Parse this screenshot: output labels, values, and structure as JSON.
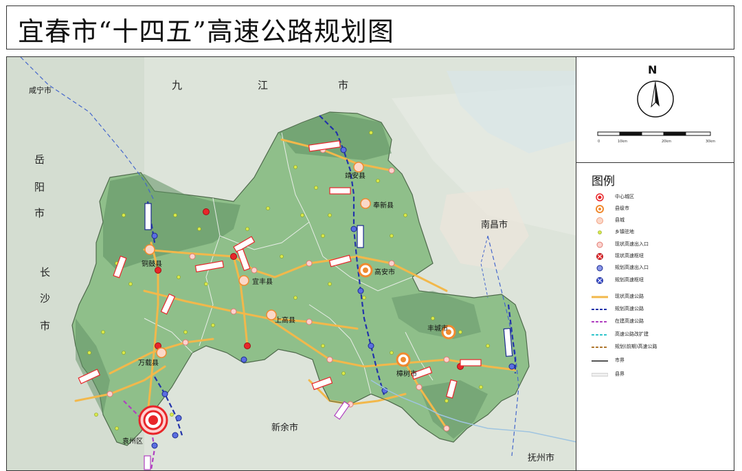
{
  "title": "宜春市“十四五”高速公路规划图",
  "north_label": "N",
  "scale_bar": {
    "ticks": [
      "0",
      "10km",
      "20km",
      "30km"
    ]
  },
  "legend": {
    "title": "图例",
    "items": [
      {
        "label": "中心城区",
        "icon": "center-city-icon"
      },
      {
        "label": "县级市",
        "icon": "county-city-icon"
      },
      {
        "label": "县城",
        "icon": "county-town-icon"
      },
      {
        "label": "乡镇驻地",
        "icon": "township-icon"
      },
      {
        "label": "现状高速出入口",
        "icon": "existing-exit-icon"
      },
      {
        "label": "现状高速枢纽",
        "icon": "existing-hub-icon"
      },
      {
        "label": "规划高速出入口",
        "icon": "planned-exit-icon"
      },
      {
        "label": "规划高速枢纽",
        "icon": "planned-hub-icon"
      },
      {
        "label": "现状高速公路",
        "icon": "existing-expressway-line"
      },
      {
        "label": "规划高速公路",
        "icon": "planned-expressway-line"
      },
      {
        "label": "在建高速公路",
        "icon": "under-construction-line"
      },
      {
        "label": "高速公路改扩建",
        "icon": "expansion-line"
      },
      {
        "label": "规划(前期)高速公路",
        "icon": "preliminary-planned-line"
      },
      {
        "label": "市界",
        "icon": "city-boundary-line"
      },
      {
        "label": "县界",
        "icon": "county-boundary-line"
      }
    ]
  },
  "map_labels": {
    "jiujiang_1": "九",
    "jiujiang_2": "江",
    "jiujiang_3": "市",
    "xianning": "咸宁市",
    "yueyang_1": "岳",
    "yueyang_2": "阳",
    "yueyang_3": "市",
    "changsha_1": "长",
    "changsha_2": "沙",
    "changsha_3": "市",
    "nanchang": "南昌市",
    "xinyu": "新余市",
    "fuzhou": "抚州市",
    "jingan": "靖安县",
    "fengxin": "奉新县",
    "tonggu": "铜鼓县",
    "yifeng": "宜丰县",
    "gaoan": "高安市",
    "shanggao": "上高县",
    "fengcheng": "丰城市",
    "zhangshu": "樟树市",
    "wanzai": "万载县",
    "yuanzhou": "袁州区"
  },
  "colors": {
    "existing_expressway": "#f2b84b",
    "planned_expressway": "#2233aa",
    "under_construction": "#b040c0",
    "expansion": "#33c6cc",
    "city_boundary": "#555555",
    "county_boundary": "#cccccc",
    "prefecture_fill": "#8fbf8a",
    "center_city": "#e8262a",
    "county_city": "#f08a30"
  }
}
